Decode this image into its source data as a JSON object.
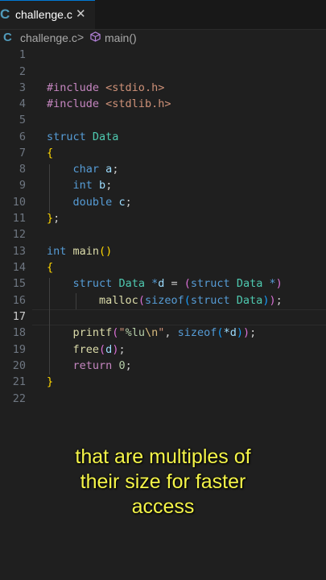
{
  "tab": {
    "icon": "C",
    "label": "challenge.c",
    "close": "✕"
  },
  "breadcrumb": {
    "file_icon": "C",
    "file": "challenge.c",
    "separator": ">",
    "symbol_icon": "cube-icon",
    "function": "main()"
  },
  "line_numbers": [
    "1",
    "2",
    "3",
    "4",
    "5",
    "6",
    "7",
    "8",
    "9",
    "10",
    "11",
    "12",
    "13",
    "14",
    "15",
    "16",
    "17",
    "18",
    "19",
    "20",
    "21",
    "22"
  ],
  "active_line": "17",
  "code": {
    "l3_directive": "#include",
    "l3_header": "<stdio.h>",
    "l4_directive": "#include",
    "l4_header": "<stdlib.h>",
    "l6_kw": "struct",
    "l6_type": "Data",
    "l7_brace": "{",
    "l8_kw": "char",
    "l8_var": "a",
    "l8_semi": ";",
    "l9_kw": "int",
    "l9_var": "b",
    "l9_semi": ";",
    "l10_kw": "double",
    "l10_var": "c",
    "l10_semi": ";",
    "l11_brace": "}",
    "l11_semi": ";",
    "l13_kw": "int",
    "l13_fn": "main",
    "l13_parens": "()",
    "l14_brace": "{",
    "l15_kw": "struct",
    "l15_type": "Data",
    "l15_op": "*",
    "l15_var": "d",
    "l15_eq": " = ",
    "l15_paren": "(",
    "l15_kw2": "struct",
    "l15_type2": "Data",
    "l15_star": "*",
    "l15_cparen": ")",
    "l16_fn": "malloc",
    "l16_paren1": "(",
    "l16_kw": "sizeof",
    "l16_paren2": "(",
    "l16_kw2": "struct",
    "l16_type": "Data",
    "l16_cparen2": ")",
    "l16_cparen1": ")",
    "l16_semi": ";",
    "l18_fn": "printf",
    "l18_paren": "(",
    "l18_str1": "\"",
    "l18_fmt": "%lu",
    "l18_esc": "\\n",
    "l18_str2": "\"",
    "l18_comma": ", ",
    "l18_kw": "sizeof",
    "l18_paren2": "(",
    "l18_deref": "*d",
    "l18_cparen2": ")",
    "l18_cparen": ")",
    "l18_semi": ";",
    "l19_fn": "free",
    "l19_paren": "(",
    "l19_var": "d",
    "l19_cparen": ")",
    "l19_semi": ";",
    "l20_kw": "return",
    "l20_num": "0",
    "l20_semi": ";",
    "l21_brace": "}"
  },
  "caption": {
    "line1": "that are multiples of",
    "line2": "their size for faster",
    "line3": "access"
  }
}
